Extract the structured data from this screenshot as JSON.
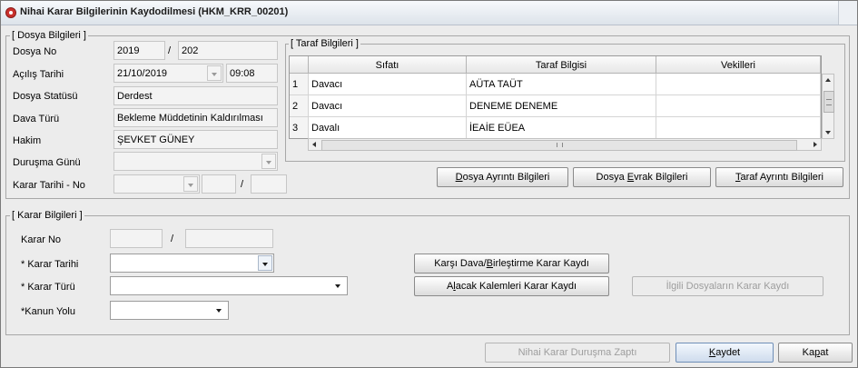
{
  "window": {
    "title": "Nihai Karar Bilgilerinin Kaydodilmesi (HKM_KRR_00201)"
  },
  "dosya": {
    "group_title": "[ Dosya Bilgileri ]",
    "dosya_no_label": "Dosya No",
    "dosya_yil": "2019",
    "dosya_sira": "202",
    "acilis_tarihi_label": "Açılış Tarihi",
    "acilis_tarihi": "21/10/2019",
    "acilis_saati": "09:08",
    "statu_label": "Dosya Statüsü",
    "statu": "Derdest",
    "dava_turu_label": "Dava Türü",
    "dava_turu": "Bekleme Müddetinin Kaldırılması",
    "hakim_label": "Hakim",
    "hakim": "ŞEVKET GÜNEY",
    "durusma_gunu_label": "Duruşma Günü",
    "durusma_gunu": "",
    "karar_tarihi_no_label": "Karar Tarihi - No",
    "slash": "/"
  },
  "taraf": {
    "group_title": "[ Taraf Bilgileri ]",
    "columns": [
      "Sıfatı",
      "Taraf Bilgisi",
      "Vekilleri"
    ],
    "rows": [
      {
        "num": "1",
        "sifati": "Davacı",
        "taraf": "AÜTA TAÜT",
        "vekil": ""
      },
      {
        "num": "2",
        "sifati": "Davacı",
        "taraf": "DENEME DENEME",
        "vekil": ""
      },
      {
        "num": "3",
        "sifati": "Davalı",
        "taraf": "İEAİE EÜEA",
        "vekil": ""
      }
    ],
    "scroll_mark": "|||"
  },
  "dosya_buttons": {
    "ayrinti_pre": "",
    "ayrinti_key": "D",
    "ayrinti_post": "osya Ayrıntı Bilgileri",
    "evrak_pre": "Dosya ",
    "evrak_key": "E",
    "evrak_post": "vrak Bilgileri",
    "taraf_pre": "",
    "taraf_key": "T",
    "taraf_post": "araf Ayrıntı Bilgileri"
  },
  "karar": {
    "group_title": "[ Karar Bilgileri ]",
    "karar_no_label": "Karar No",
    "slash": "/",
    "karar_tarihi_label": "* Karar Tarihi",
    "karar_turu_label": "* Karar Türü",
    "kanun_yolu_label": "*Kanun Yolu",
    "karsi_pre": "Karşı Dava/",
    "karsi_key": "B",
    "karsi_post": "irleştirme Karar Kaydı",
    "alacak_pre": "A",
    "alacak_key": "l",
    "alacak_post": "acak Kalemleri Karar Kaydı",
    "ilgili_label": "İlgili Dosyaların Karar Kaydı"
  },
  "footer": {
    "zapt_label": "Nihai Karar Duruşma Zaptı",
    "kaydet_key": "K",
    "kaydet_post": "aydet",
    "kapat_pre": "Ka",
    "kapat_key": "p",
    "kapat_post": "at"
  }
}
